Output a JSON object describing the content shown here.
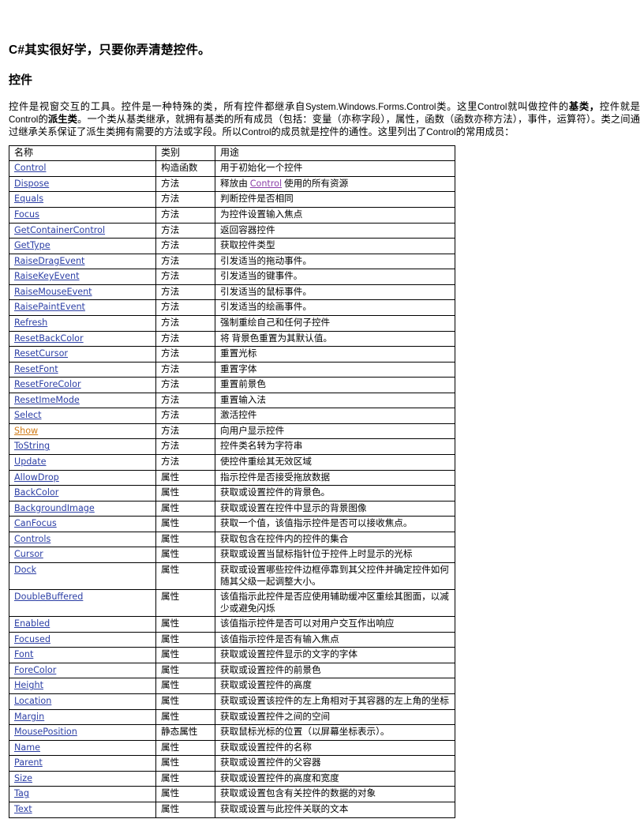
{
  "document": {
    "title": "C#其实很好学，只要你弄清楚控件。",
    "section_heading": "控件",
    "intro_parts": {
      "p1": "控件是视窗交互的工具。控件是一种特殊的类，所有控件都继承自",
      "p2_mono": "System.Windows.Forms.Control",
      "p3": "类。这里",
      "p4_mono": "Control",
      "p5": "就叫做控件的",
      "p6_bold": "基类，",
      "p7": "控件就是",
      "p8_mono": "Control",
      "p9": "的",
      "p10_bold": "派生类",
      "p11": "。一个类从基类继承，就拥有基类的所有成员（包括：变量（亦称字段），属性，函数（函数亦称方法），事件，运算符）。类之间通过继承关系保证了派生类拥有需要的方法或字段。所以",
      "p12_mono": "Control",
      "p13": "的成员就是控件的通性。这里列出了",
      "p14_mono": "Control",
      "p15": "的常用成员："
    }
  },
  "colors": {
    "link": "#2c3fa5",
    "link_visited": "#d07a16",
    "link_inline": "#8b3fa8",
    "border": "#000000",
    "text": "#000000"
  },
  "table": {
    "headers": [
      "名称",
      "类别",
      "用途"
    ],
    "rows": [
      {
        "name": "Control",
        "link": true,
        "kind": "构造函数",
        "desc": "用于初始化一个控件"
      },
      {
        "name": "Dispose",
        "link": true,
        "kind": "方法",
        "desc_pre": "释放由 ",
        "desc_link": "Control",
        "desc_post": " 使用的所有资源"
      },
      {
        "name": "Equals",
        "link": true,
        "kind": "方法",
        "desc": "判断控件是否相同"
      },
      {
        "name": "Focus",
        "link": true,
        "kind": "方法",
        "desc": "为控件设置输入焦点"
      },
      {
        "name": "GetContainerControl",
        "link": true,
        "kind": "方法",
        "desc": "返回容器控件"
      },
      {
        "name": "GetType",
        "link": true,
        "kind": "方法",
        "desc": "获取控件类型"
      },
      {
        "name": "RaiseDragEvent",
        "link": true,
        "kind": "方法",
        "desc": "引发适当的拖动事件。"
      },
      {
        "name": "RaiseKeyEvent",
        "link": true,
        "kind": "方法",
        "desc": "引发适当的键事件。"
      },
      {
        "name": "RaiseMouseEvent",
        "link": true,
        "kind": "方法",
        "desc": "引发适当的鼠标事件。"
      },
      {
        "name": "RaisePaintEvent",
        "link": true,
        "kind": "方法",
        "desc": "引发适当的绘画事件。"
      },
      {
        "name": "Refresh",
        "link": true,
        "kind": "方法",
        "desc": "强制重绘自己和任何子控件"
      },
      {
        "name": "ResetBackColor",
        "link": true,
        "kind": "方法",
        "desc": "将 背景色重置为其默认值。"
      },
      {
        "name": "ResetCursor",
        "link": true,
        "kind": "方法",
        "desc": "重置光标"
      },
      {
        "name": "ResetFont",
        "link": true,
        "kind": "方法",
        "desc": "重置字体"
      },
      {
        "name": "ResetForeColor",
        "link": true,
        "kind": "方法",
        "desc": "重置前景色"
      },
      {
        "name": "ResetImeMode",
        "link": true,
        "kind": "方法",
        "desc": "重置输入法"
      },
      {
        "name": "Select",
        "link": true,
        "kind": "方法",
        "desc": "激活控件"
      },
      {
        "name": "Show",
        "link": true,
        "visited": true,
        "kind": "方法",
        "desc": "向用户显示控件"
      },
      {
        "name": "ToString",
        "link": true,
        "kind": "方法",
        "desc": "控件类名转为字符串"
      },
      {
        "name": "Update",
        "link": true,
        "kind": "方法",
        "desc": "使控件重绘其无效区域"
      },
      {
        "name": "AllowDrop",
        "link": true,
        "kind": "属性",
        "desc": "指示控件是否接受拖放数据"
      },
      {
        "name": "BackColor",
        "link": true,
        "kind": "属性",
        "desc": "获取或设置控件的背景色。"
      },
      {
        "name": "BackgroundImage",
        "link": true,
        "kind": "属性",
        "desc": "获取或设置在控件中显示的背景图像"
      },
      {
        "name": "CanFocus",
        "link": true,
        "kind": "属性",
        "desc": "获取一个值，该值指示控件是否可以接收焦点。"
      },
      {
        "name": "Controls",
        "link": true,
        "kind": "属性",
        "desc": "获取包含在控件内的控件的集合"
      },
      {
        "name": "Cursor",
        "link": true,
        "kind": "属性",
        "desc": "获取或设置当鼠标指针位于控件上时显示的光标"
      },
      {
        "name": "Dock",
        "link": true,
        "kind": "属性",
        "desc": "获取或设置哪些控件边框停靠到其父控件并确定控件如何随其父级一起调整大小。"
      },
      {
        "name": "DoubleBuffered",
        "link": true,
        "kind": "属性",
        "desc": "该值指示此控件是否应使用辅助缓冲区重绘其图面，以减少或避免闪烁"
      },
      {
        "name": "Enabled",
        "link": true,
        "kind": "属性",
        "desc": "该值指示控件是否可以对用户交互作出响应"
      },
      {
        "name": "Focused",
        "link": true,
        "kind": "属性",
        "desc": "该值指示控件是否有输入焦点"
      },
      {
        "name": "Font",
        "link": true,
        "kind": "属性",
        "desc": "获取或设置控件显示的文字的字体"
      },
      {
        "name": "ForeColor",
        "link": true,
        "kind": "属性",
        "desc": "获取或设置控件的前景色"
      },
      {
        "name": "Height",
        "link": true,
        "kind": "属性",
        "desc": "获取或设置控件的高度"
      },
      {
        "name": "Location",
        "link": true,
        "kind": "属性",
        "desc": "获取或设置该控件的左上角相对于其容器的左上角的坐标"
      },
      {
        "name": "Margin",
        "link": true,
        "kind": "属性",
        "desc": "获取或设置控件之间的空间"
      },
      {
        "name": "MousePosition",
        "link": true,
        "kind": "静态属性",
        "desc": "获取鼠标光标的位置（以屏幕坐标表示）。"
      },
      {
        "name": "Name",
        "link": true,
        "kind": "属性",
        "desc": "获取或设置控件的名称"
      },
      {
        "name": "Parent",
        "link": true,
        "kind": "属性",
        "desc": "获取或设置控件的父容器"
      },
      {
        "name": "Size",
        "link": true,
        "kind": "属性",
        "desc": "获取或设置控件的高度和宽度"
      },
      {
        "name": "Tag",
        "link": true,
        "kind": "属性",
        "desc": "获取或设置包含有关控件的数据的对象"
      },
      {
        "name": "Text",
        "link": true,
        "kind": "属性",
        "desc": "获取或设置与此控件关联的文本"
      }
    ]
  }
}
